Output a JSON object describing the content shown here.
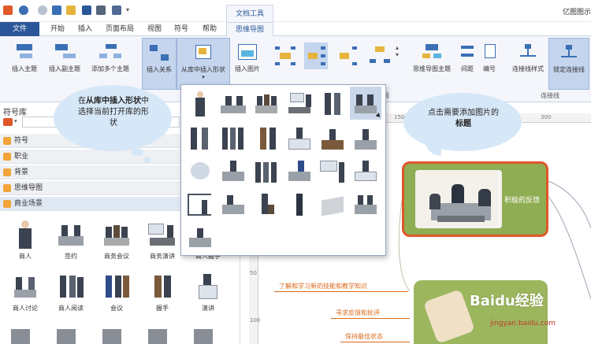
{
  "titlebar": {
    "tool_tab": "文档工具",
    "app_title": "亿图图示"
  },
  "tabs": [
    {
      "label": "文件"
    },
    {
      "label": "开始"
    },
    {
      "label": "插入"
    },
    {
      "label": "页面布局"
    },
    {
      "label": "视图"
    },
    {
      "label": "符号"
    },
    {
      "label": "帮助"
    },
    {
      "label": "思维导图"
    }
  ],
  "ribbon": {
    "insert_topic": "插入主题",
    "insert_subtopic": "插入副主题",
    "add_multiple": "添加多个主题",
    "insert_relation": "插入关系",
    "insert_from_lib": "从库中插入形状",
    "insert_image": "插入图片",
    "mindmap_theme": "思维导图主题",
    "spacing": "间距",
    "numbering": "编号",
    "connector_style": "连接线样式",
    "lock_connector": "锁定连接线",
    "group_layout_partial": "局",
    "group_connector": "连接线"
  },
  "left_panel": {
    "title": "符号库",
    "categories": [
      {
        "label": "符号"
      },
      {
        "label": "职业"
      },
      {
        "label": "背景"
      },
      {
        "label": "思维导图"
      },
      {
        "label": "商业场景"
      }
    ],
    "shapes_row1": [
      "商人",
      "签约",
      "商务会议",
      "商务演讲",
      "商人握手"
    ],
    "shapes_row2": [
      "商人讨论",
      "商人阅读",
      "会议",
      "握手",
      "演讲"
    ]
  },
  "callouts": {
    "left_pre": "在",
    "left_bold": "从库中插入形状",
    "left_post": "中选择当前打开库的形状",
    "right_pre": "点击需要添加图片的",
    "right_bold": "标题"
  },
  "canvas": {
    "ruler_marks": [
      "150",
      "200",
      "250",
      "300"
    ],
    "left_ruler_marks": [
      "50",
      "100"
    ],
    "main_node_label": "积极的反馈",
    "branches": [
      {
        "label": "了解和学习新的技能和教学知识"
      },
      {
        "label": "寻求反馈和批评"
      },
      {
        "label": "保持最佳状态"
      }
    ],
    "watermark": "Baidu经验",
    "watermark_url": "jingyan.baidu.com"
  },
  "colors": {
    "ribbon_blue": "#2b579a",
    "node_green": "#8fad53",
    "node_border": "#e0572b",
    "branch_orange": "#d86a1d",
    "category_icon": "#f2a43a",
    "cloud": "#d6e7f7"
  }
}
